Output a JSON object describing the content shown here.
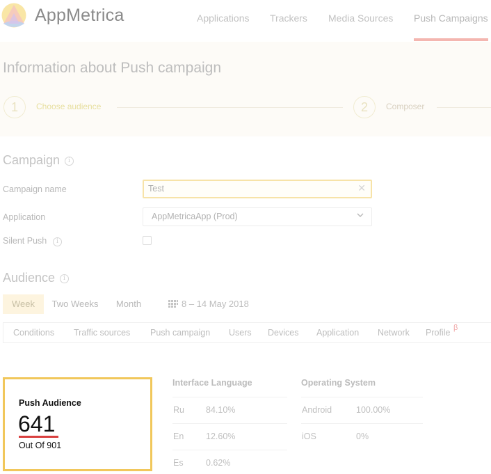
{
  "header": {
    "brand": "AppMetrica",
    "nav": [
      "Applications",
      "Trackers",
      "Media Sources",
      "Push Campaigns"
    ],
    "active_nav": "Push Campaigns"
  },
  "page": {
    "title": "Information about Push campaign",
    "steps": [
      {
        "number": "1",
        "label": "Choose audience"
      },
      {
        "number": "2",
        "label": "Composer"
      }
    ]
  },
  "campaign": {
    "title": "Campaign",
    "name_label": "Campaign name",
    "name_value": "Test",
    "application_label": "Application",
    "application_value": "AppMetricaApp (Prod)",
    "silent_push_label": "Silent Push"
  },
  "audience": {
    "title": "Audience",
    "periods": [
      "Week",
      "Two Weeks",
      "Month"
    ],
    "active_period": "Week",
    "date_range": "8 – 14 May 2018",
    "tabs": [
      "Conditions",
      "Traffic sources",
      "Push campaign",
      "Users",
      "Devices",
      "Application",
      "Network",
      "Profile"
    ],
    "beta_mark": "β"
  },
  "push_audience": {
    "title": "Push Audience",
    "count": "641",
    "subtitle": "Out Of 901"
  },
  "interface_language": {
    "title": "Interface Language",
    "rows": [
      {
        "name": "Ru",
        "value": "84.10%"
      },
      {
        "name": "En",
        "value": "12.60%"
      },
      {
        "name": "Es",
        "value": "0.62%"
      }
    ]
  },
  "operating_system": {
    "title": "Operating System",
    "rows": [
      {
        "name": "Android",
        "value": "100.00%"
      },
      {
        "name": "iOS",
        "value": "0%"
      }
    ]
  },
  "colors": {
    "nav_underline": "#f4b6b0",
    "card_border": "#f1c75b",
    "count_underline": "#d9403f",
    "input_focus_border": "#f7e3a8"
  }
}
